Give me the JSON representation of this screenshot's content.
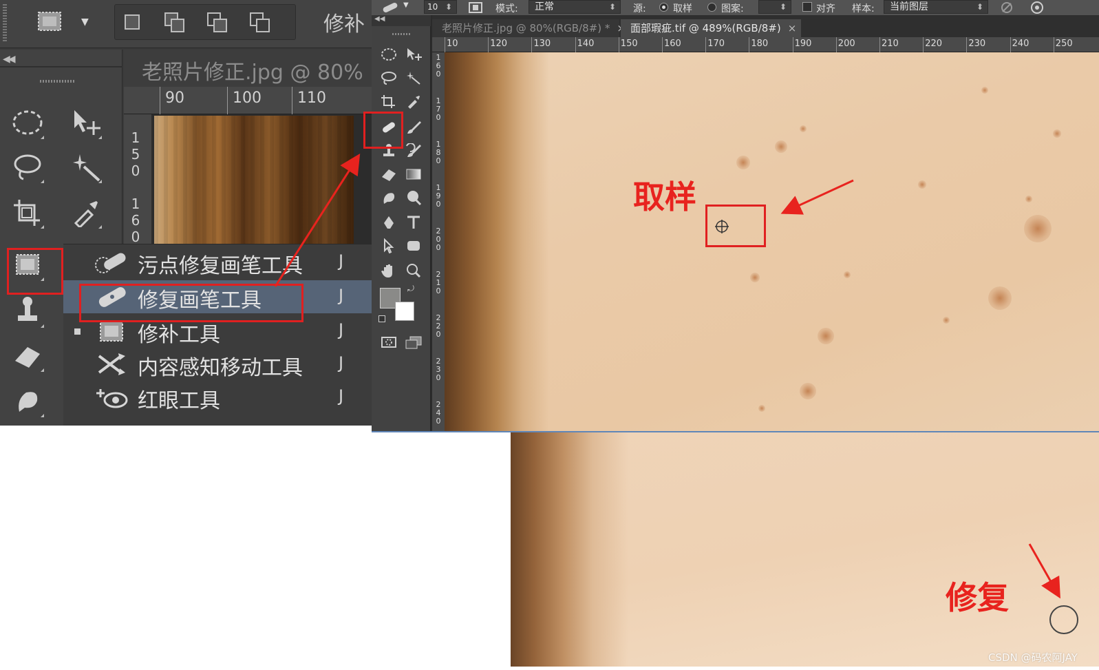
{
  "left_panel": {
    "options_bar": {
      "cut_text": "修补"
    },
    "doc_tab": "老照片修正.jpg @ 80%",
    "h_ruler": [
      "90",
      "100",
      "110"
    ],
    "v_ruler": [
      "1",
      "5",
      "0",
      "1",
      "6",
      "0"
    ],
    "flyout": [
      {
        "label": "污点修复画笔工具",
        "key": "J",
        "icon": "spot-healing-brush-icon",
        "active": false
      },
      {
        "label": "修复画笔工具",
        "key": "J",
        "icon": "healing-brush-icon",
        "active": true
      },
      {
        "label": "修补工具",
        "key": "J",
        "icon": "patch-icon",
        "active": false
      },
      {
        "label": "内容感知移动工具",
        "key": "J",
        "icon": "content-aware-move-icon",
        "active": false
      },
      {
        "label": "红眼工具",
        "key": "J",
        "icon": "red-eye-icon",
        "active": false
      }
    ]
  },
  "options_bar": {
    "brush_size": "10",
    "mode_label": "模式:",
    "mode_value": "正常",
    "source_label": "源:",
    "source_sampled": "取样",
    "source_pattern": "图案:",
    "align_label": "对齐",
    "sample_label": "样本:",
    "sample_value": "当前图层"
  },
  "tabs": [
    {
      "label": "老照片修正.jpg @ 80%(RGB/8#) *",
      "close": "×",
      "active": false
    },
    {
      "label": "面部瑕疵.tif @ 489%(RGB/8#)",
      "close": "×",
      "active": true
    }
  ],
  "h_ruler": [
    "10",
    "120",
    "130",
    "140",
    "150",
    "160",
    "170",
    "180",
    "190",
    "200",
    "210",
    "220",
    "230",
    "240",
    "250"
  ],
  "v_ruler": [
    [
      "1",
      "6",
      "0"
    ],
    [
      "1",
      "7",
      "0"
    ],
    [
      "1",
      "8",
      "0"
    ],
    [
      "1",
      "9",
      "0"
    ],
    [
      "2",
      "0",
      "0"
    ],
    [
      "2",
      "1",
      "0"
    ],
    [
      "2",
      "2",
      "0"
    ],
    [
      "2",
      "3",
      "0"
    ],
    [
      "2",
      "4",
      "0"
    ]
  ],
  "annotations": {
    "sample": "取样",
    "repair": "修复"
  },
  "watermark": "CSDN @码农阿JAY",
  "colors": {
    "annotation_red": "#e8231e",
    "active_menu": "#566477",
    "ps_panel": "#424242"
  }
}
